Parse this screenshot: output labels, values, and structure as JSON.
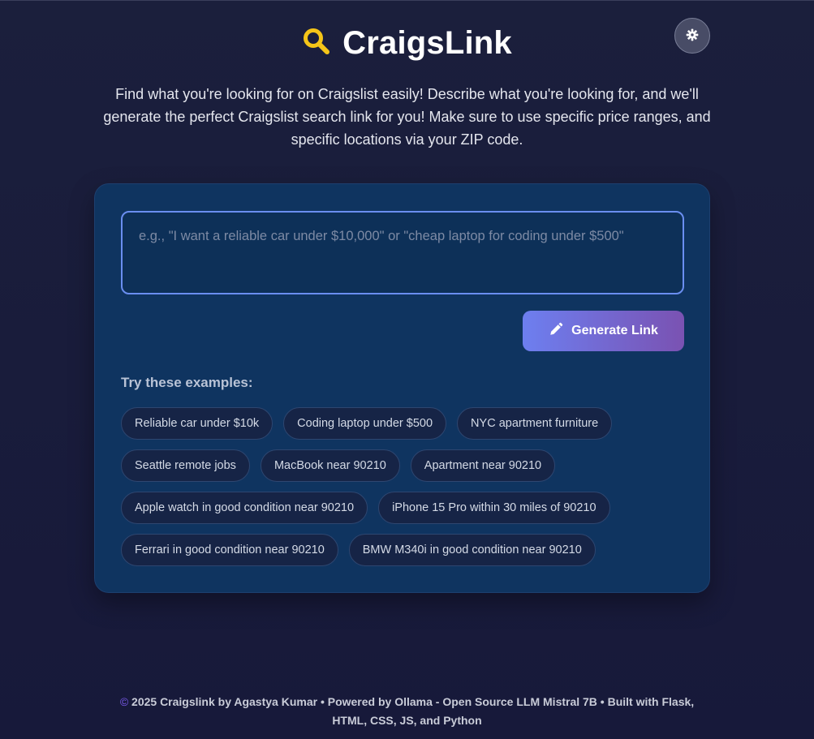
{
  "header": {
    "title": "CraigsLink",
    "icon": "search-icon",
    "icon_color": "#f5c518"
  },
  "theme_toggle": {
    "icon": "gear-icon"
  },
  "tagline": "Find what you're looking for on Craigslist easily! Describe what you're looking for, and we'll generate the perfect Craigslist search link for you! Make sure to use specific price ranges, and specific locations via your ZIP code.",
  "search": {
    "value": "",
    "placeholder": "e.g., \"I want a reliable car under $10,000\" or \"cheap laptop for coding under $500\""
  },
  "generate_button": {
    "label": "Generate Link",
    "icon": "pencil-icon"
  },
  "examples": {
    "title": "Try these examples:",
    "items": [
      "Reliable car under $10k",
      "Coding laptop under $500",
      "NYC apartment furniture",
      "Seattle remote jobs",
      "MacBook near 90210",
      "Apartment near 90210",
      "Apple watch in good condition near 90210",
      "iPhone 15 Pro within 30 miles of 90210",
      "Ferrari in good condition near 90210",
      "BMW M340i in good condition near 90210"
    ]
  },
  "footer": {
    "copyright_symbol": "©",
    "line1": "2025 Craigslink by Agastya Kumar • Powered by Ollama - Open Source LLM Mistral 7B • Built with Flask,",
    "line2": "HTML, CSS, JS, and Python"
  },
  "colors": {
    "background": "#1b1f3c",
    "card": "#0f3460",
    "accent_start": "#6d7ff0",
    "accent_end": "#7a52b2",
    "input_border": "#6a8ef0"
  }
}
